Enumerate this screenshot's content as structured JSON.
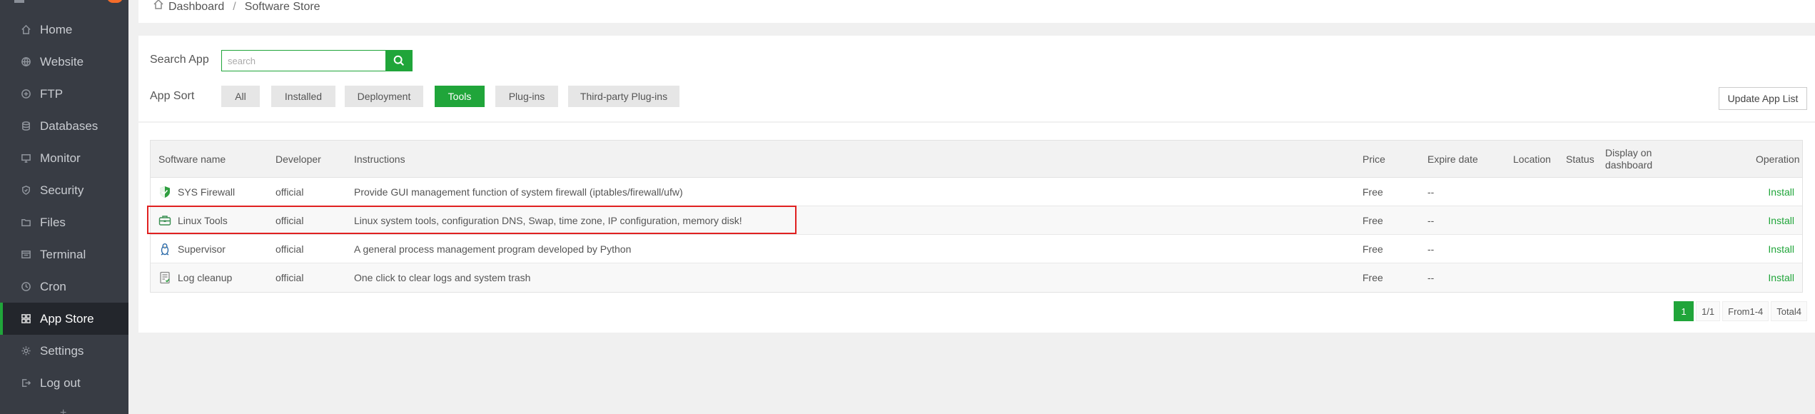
{
  "sidebar": {
    "items": [
      {
        "label": "Home",
        "icon": "home-icon"
      },
      {
        "label": "Website",
        "icon": "globe-icon"
      },
      {
        "label": "FTP",
        "icon": "ftp-icon"
      },
      {
        "label": "Databases",
        "icon": "database-icon"
      },
      {
        "label": "Monitor",
        "icon": "monitor-icon"
      },
      {
        "label": "Security",
        "icon": "shield-icon"
      },
      {
        "label": "Files",
        "icon": "folder-icon"
      },
      {
        "label": "Terminal",
        "icon": "terminal-icon"
      },
      {
        "label": "Cron",
        "icon": "clock-icon"
      },
      {
        "label": "App Store",
        "icon": "apps-icon"
      },
      {
        "label": "Settings",
        "icon": "gear-icon"
      },
      {
        "label": "Log out",
        "icon": "logout-icon"
      }
    ],
    "active": "App Store"
  },
  "breadcrumb": {
    "home": "Dashboard",
    "separator": "/",
    "current": "Software Store"
  },
  "search": {
    "label": "Search App",
    "placeholder": "search"
  },
  "sort": {
    "label": "App Sort",
    "options": [
      "All",
      "Installed",
      "Deployment",
      "Tools",
      "Plug-ins",
      "Third-party Plug-ins"
    ],
    "selected": "Tools"
  },
  "update_button": "Update App List",
  "table": {
    "headers": {
      "name": "Software name",
      "developer": "Developer",
      "instructions": "Instructions",
      "price": "Price",
      "expire": "Expire date",
      "location": "Location",
      "status": "Status",
      "display": "Display on dashboard",
      "operation": "Operation"
    },
    "rows": [
      {
        "icon": "firewall-icon",
        "name": "SYS Firewall",
        "developer": "official",
        "instructions": "Provide GUI management function of system firewall (iptables/firewall/ufw)",
        "price": "Free",
        "expire": "--",
        "operation": "Install"
      },
      {
        "icon": "toolbox-icon",
        "name": "Linux Tools",
        "developer": "official",
        "instructions": "Linux system tools, configuration DNS, Swap, time zone, IP configuration, memory disk!",
        "price": "Free",
        "expire": "--",
        "operation": "Install"
      },
      {
        "icon": "penguin-icon",
        "name": "Supervisor",
        "developer": "official",
        "instructions": "A general process management program developed by Python",
        "price": "Free",
        "expire": "--",
        "operation": "Install"
      },
      {
        "icon": "log-cleanup-icon",
        "name": "Log cleanup",
        "developer": "official",
        "instructions": "One click to clear logs and system trash",
        "price": "Free",
        "expire": "--",
        "operation": "Install"
      }
    ]
  },
  "pagination": {
    "current": "1",
    "pages": "1/1",
    "range": "From1-4",
    "total": "Total4"
  },
  "colors": {
    "accent": "#20a53a",
    "sidebar_bg": "#383c44",
    "highlight": "#e02020"
  }
}
